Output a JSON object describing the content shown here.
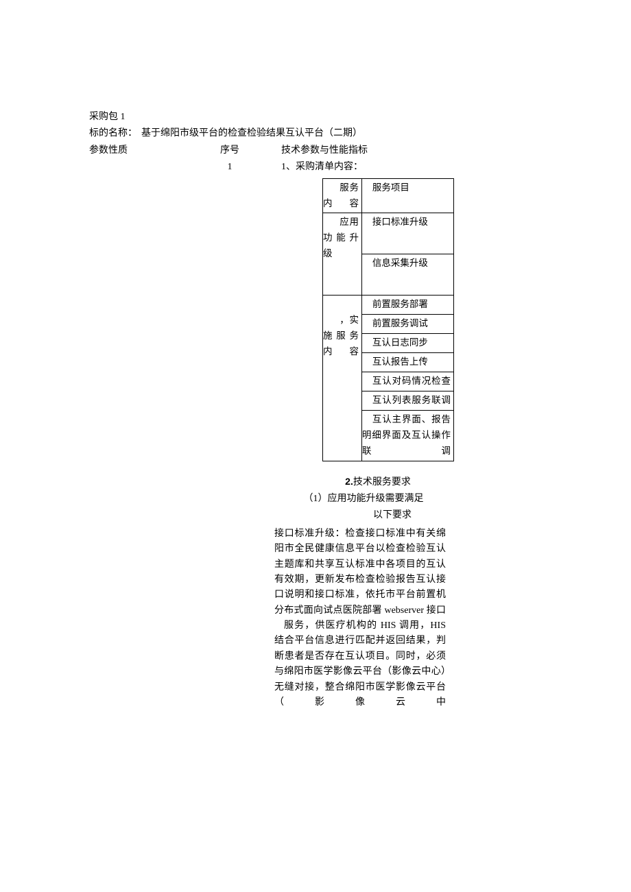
{
  "package_label": "采购包 1",
  "subject_label": "标的名称：",
  "subject_value": "基于绵阳市级平台的检查检验结果互认平台（二期）",
  "headers": {
    "param": "参数性质",
    "seq": "序号",
    "tech": "技术参数与性能指标"
  },
  "seq_value": "1",
  "list_intro": "1、采购清单内容：",
  "table": {
    "r1c1": "服务内容",
    "r1c2": "服务项目",
    "r2c1": "应用功能升级",
    "r2c2a": "接口标准升级",
    "r2c2b": "信息采集升级",
    "r3c1": "，实施服务内容",
    "r3_items": [
      "前置服务部署",
      "前置服务调试",
      "互认日志同步",
      "互认报告上传",
      "互认对码情况检查",
      "互认列表服务联调",
      "互认主界面、报告明细界面及互认操作联调"
    ]
  },
  "req": {
    "title_num": "2.",
    "title_text": "技术服务要求",
    "sub1": "（1）应用功能升级需要满足",
    "sub2": "以下要求",
    "body1": "接口标准升级：检查接口标准中有关绵阳市全民健康信息平台以检查检验互认主题库和共享互认标准中各项目的互认有效期，更新发布检查检验报告互认接口说明和接口标准，依托市平台前置机分布式面向试点医院部署 webserver 接口",
    "body2": "服务，供医疗机构的 HIS 调用，HIS 结合平台信息进行匹配并返回结果，判断患者是否存在互认项目。同时，必须与绵阳市医学影像云平台（影像云中心）无缝对接，整合绵阳市医学影像云平台（影像云中"
  }
}
